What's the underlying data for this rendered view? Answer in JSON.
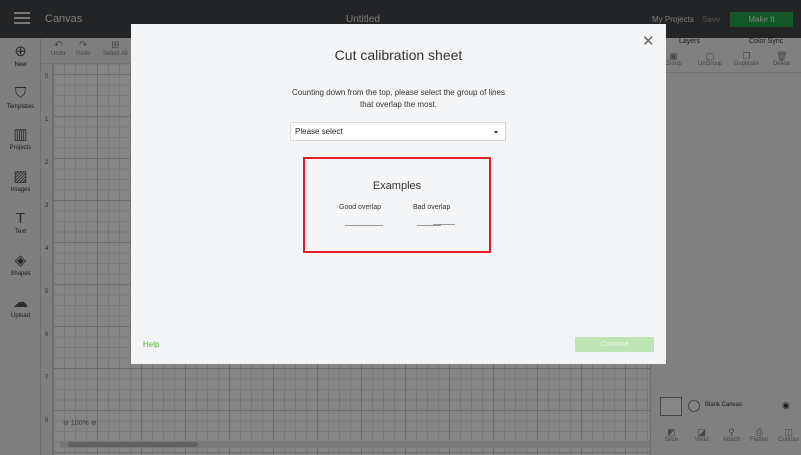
{
  "app": {
    "name": "Canvas",
    "document_title": "Untitled",
    "my_projects": "My Projects",
    "save": "Save",
    "make_it": "Make It"
  },
  "sidebar": {
    "items": [
      {
        "label": "New",
        "icon": "plus-circle-icon"
      },
      {
        "label": "Templates",
        "icon": "shirt-icon"
      },
      {
        "label": "Projects",
        "icon": "projects-icon"
      },
      {
        "label": "Images",
        "icon": "image-icon"
      },
      {
        "label": "Text",
        "icon": "text-icon"
      },
      {
        "label": "Shapes",
        "icon": "shapes-icon"
      },
      {
        "label": "Upload",
        "icon": "upload-cloud-icon"
      }
    ]
  },
  "toolbar": {
    "undo": "Undo",
    "redo": "Redo",
    "select_all": "Select All"
  },
  "ruler": [
    "0",
    "1",
    "2",
    "3",
    "4",
    "5",
    "6",
    "7",
    "8"
  ],
  "zoom": "100%",
  "right_panel": {
    "tabs": [
      "Layers",
      "Color Sync"
    ],
    "actions": [
      "Group",
      "UnGroup",
      "Duplicate",
      "Delete"
    ],
    "blank_canvas": "Blank Canvas",
    "bottom_actions": [
      "Slice",
      "Weld",
      "Attach",
      "Flatten",
      "Contour"
    ]
  },
  "modal": {
    "title": "Cut calibration sheet",
    "instruction": "Counting down from the top, please select the group of lines that overlap the most.",
    "select_placeholder": "Please select",
    "examples_title": "Examples",
    "good_label": "Good overlap",
    "bad_label": "Bad overlap",
    "help": "Help",
    "continue": "Continue",
    "highlight_color": "#e11d26",
    "accent_color": "#5fb530"
  }
}
